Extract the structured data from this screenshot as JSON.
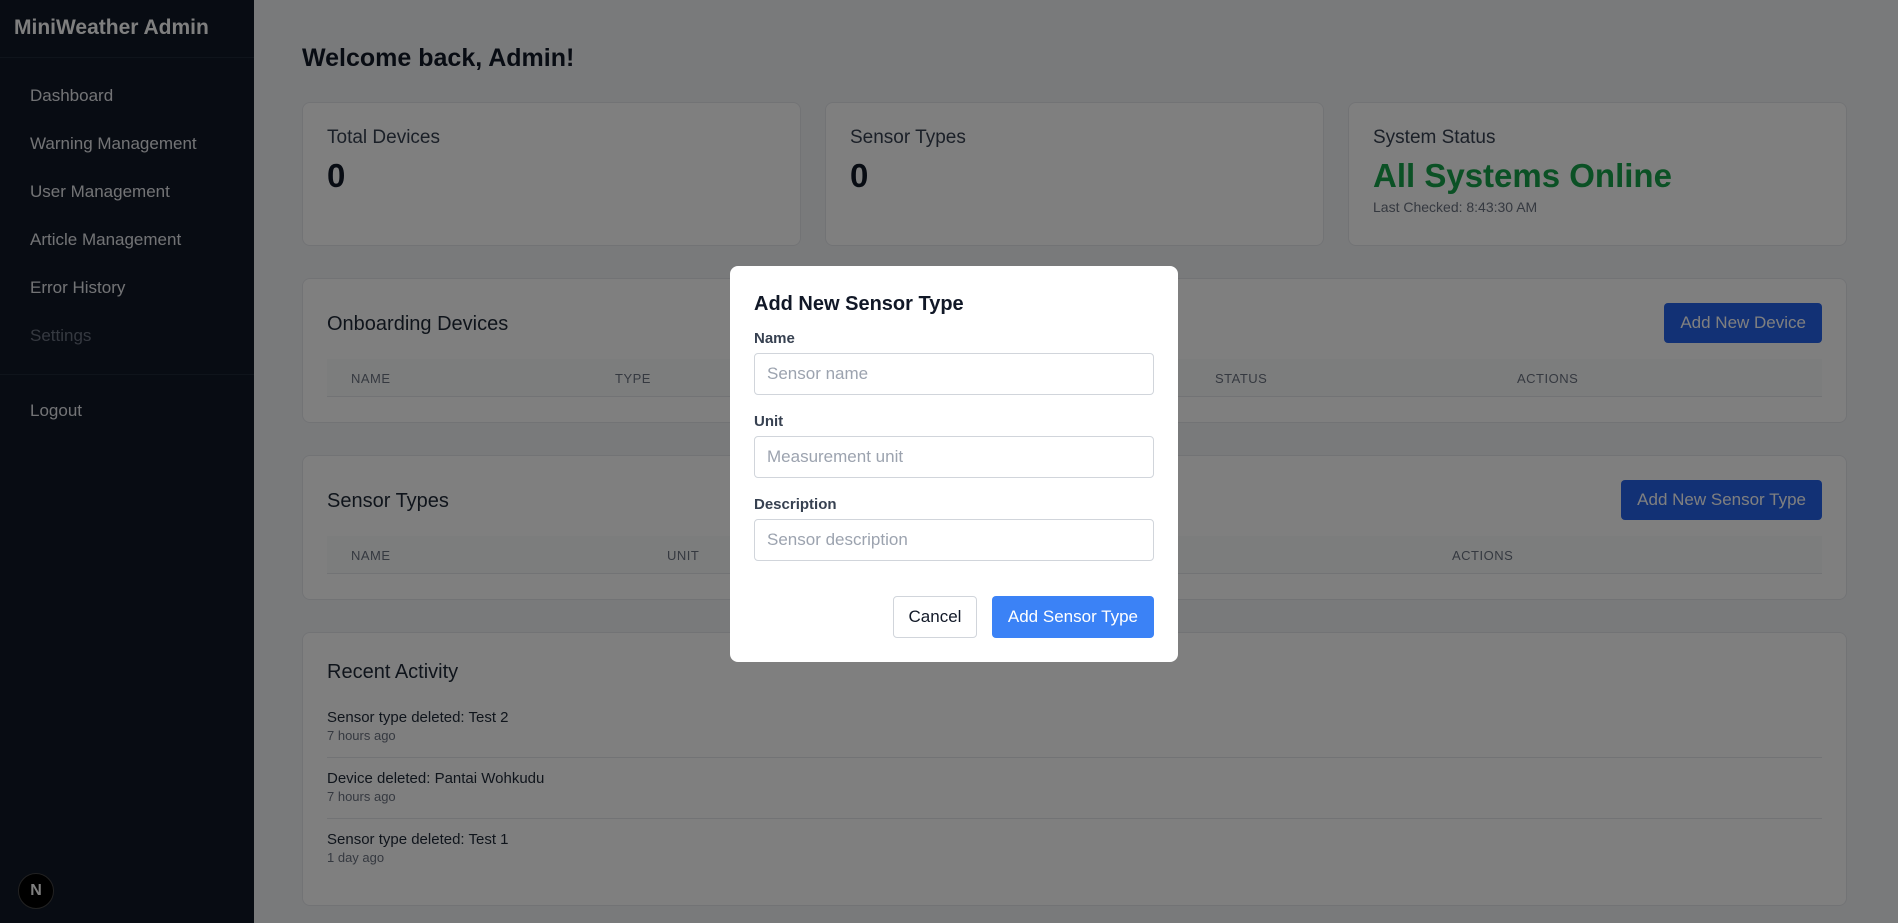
{
  "sidebar": {
    "brand": "MiniWeather Admin",
    "items": [
      {
        "label": "Dashboard"
      },
      {
        "label": "Warning Management"
      },
      {
        "label": "User Management"
      },
      {
        "label": "Article Management"
      },
      {
        "label": "Error History"
      },
      {
        "label": "Settings"
      }
    ],
    "logout": "Logout",
    "badge": "N"
  },
  "header": {
    "welcome": "Welcome back, Admin!"
  },
  "stats": {
    "devices": {
      "title": "Total Devices",
      "value": "0"
    },
    "sensor_types": {
      "title": "Sensor Types",
      "value": "0"
    },
    "system": {
      "title": "System Status",
      "value": "All Systems Online",
      "last_checked": "Last Checked: 8:43:30 AM"
    }
  },
  "onboarding": {
    "title": "Onboarding Devices",
    "add_button": "Add New Device",
    "columns": [
      "NAME",
      "TYPE",
      "STATUS",
      "ACTIONS"
    ]
  },
  "sensor_types": {
    "title": "Sensor Types",
    "add_button": "Add New Sensor Type",
    "columns": [
      "NAME",
      "UNIT",
      "ACTIONS"
    ]
  },
  "activity": {
    "title": "Recent Activity",
    "items": [
      {
        "text": "Sensor type deleted: Test 2",
        "time": "7 hours ago"
      },
      {
        "text": "Device deleted: Pantai Wohkudu",
        "time": "7 hours ago"
      },
      {
        "text": "Sensor type deleted: Test 1",
        "time": "1 day ago"
      }
    ]
  },
  "modal": {
    "title": "Add New Sensor Type",
    "name_label": "Name",
    "name_placeholder": "Sensor name",
    "name_value": "",
    "unit_label": "Unit",
    "unit_placeholder": "Measurement unit",
    "unit_value": "",
    "desc_label": "Description",
    "desc_placeholder": "Sensor description",
    "desc_value": "",
    "cancel": "Cancel",
    "submit": "Add Sensor Type"
  },
  "colors": {
    "sidebar_bg": "#111827",
    "primary": "#2563eb",
    "status_ok": "#16a34a"
  }
}
